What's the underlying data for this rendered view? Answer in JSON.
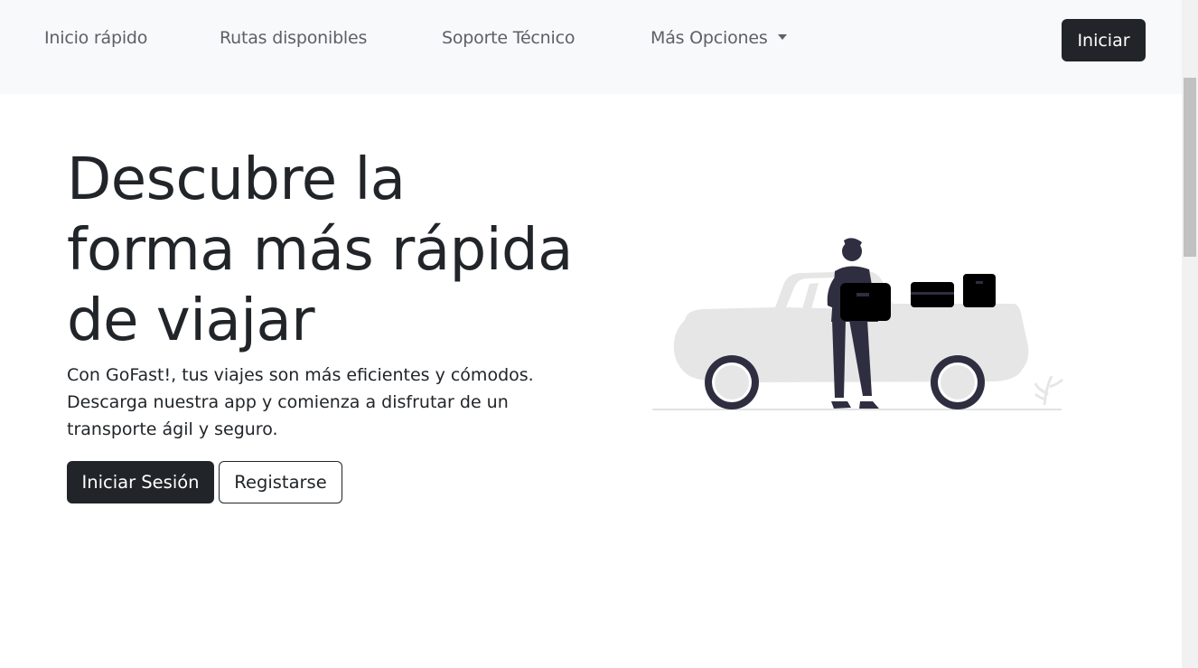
{
  "nav": {
    "items": [
      {
        "label": "Inicio rápido"
      },
      {
        "label": "Rutas disponibles"
      },
      {
        "label": "Soporte Técnico"
      },
      {
        "label": "Más Opciones"
      }
    ],
    "cta_label": "Iniciar"
  },
  "hero": {
    "title": "Descubre la forma más rápida de viajar",
    "description": "Con GoFast!, tus viajes son más eficientes y cómodos. Descarga nuestra app y comienza a disfrutar de un transporte ágil y seguro.",
    "primary_button": "Iniciar Sesión",
    "secondary_button": "Registarse"
  },
  "colors": {
    "dark": "#212529",
    "nav_background": "#f8f9fa",
    "illustration_gray": "#e6e6e6",
    "illustration_navy": "#2f2e41"
  }
}
